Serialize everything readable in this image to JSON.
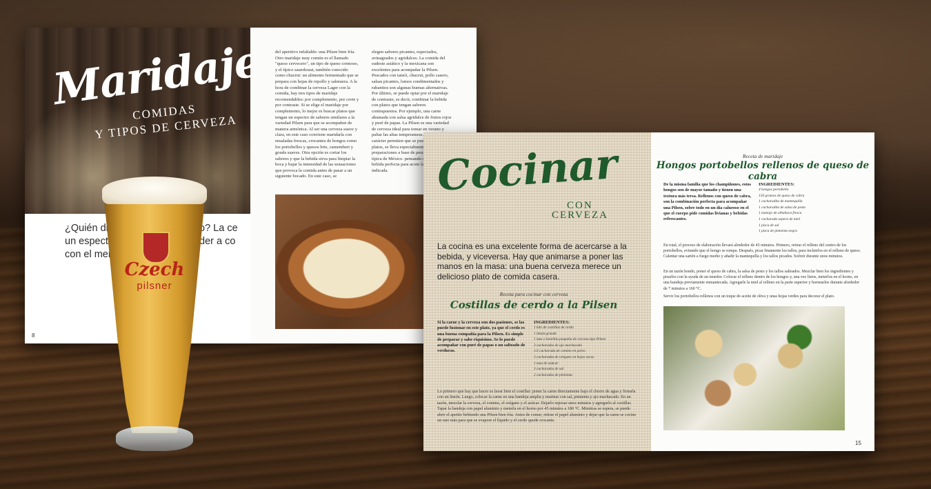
{
  "magazine1": {
    "left_page": {
      "title": "Maridajes",
      "subtitle_line1": "COMIDAS",
      "subtitle_line2": "Y TIPOS DE CERVEZA",
      "intro": "¿Quién dij del maridaje del vino? La ce un espectro y sabores c aprender a co con el menú e",
      "page_number": "8"
    },
    "right_page": {
      "col1": "del aperitivo infaltable: una Pilsen bien fría. Otro maridaje muy común es el llamado \"queso cervecero\", un tipo de queso cremoso, y el típico sauerkraut, también conocido como chucrut: un alimento fermentado que se prepara con hojas de repollo y salmuera. A la hora de combinar la cerveza Lager con la comida, hay tres tipos de maridaje recomendables: por complemento, por corte y por contraste. Si se elige el maridaje por complemento, lo mejor es buscar platos que tengan un espectro de sabores similares a la variedad Pilsen para que se acompañen de manera armónica. Al ser una cerveza suave y clara, en este caso conviene maridarla con ensaladas frescas, crocantes de hongos como los portobellos y quesos brie, camembert y gouda suaves. Otra opción es cortar los sabores y que la bebida sirva para limpiar la boca y bajar la intensidad de las sensaciones que provoca la comida antes de pasar a un siguiente bocado. En este caso, se",
      "col2": "elegen sabores picantes, especiados, avinagrados y agridulces. La comida del sudeste asiático y la mexicana son excelentes para acompañar la Pilsen. Pescados con tatsói, chucrut, pollo casero, salsas picantes, lomos condimentados y rabanitos son algunas buenas alternativas. Por último, se puede optar por el maridaje de contraste, es decir, combinar la bebida con platos que tengan sabores contrapuestos. Por ejemplo, una carne ahumada con salsa agridulce de frutos rojos y puré de papas. La Pilsen es una variedad de cerveza ideal para tomar en verano y paliar las altas temperaturas. Aunque su carácter permiten que se pueda maridar con platos, se lleva especialmente bien preparaciones a base de pesca la cocina típica de México. pensando en crear unos bu bebida perfecta para acom la Pilsen es la indicada."
    }
  },
  "glass": {
    "brand": "Czech",
    "brand2": "pilsner"
  },
  "magazine2": {
    "left_page": {
      "title": "Cocinar",
      "con": "CON",
      "cerveza": "CERVEZA",
      "intro": "La cocina es una excelente forma de acercarse a la bebida, y viceversa. Hay que animarse a poner las manos en la masa: una buena cerveza merece un delicioso plato de comida casera.",
      "kicker": "Receta para cocinar con cerveza",
      "recipe_title": "Costillas de cerdo a la Pilsen",
      "lead": "Si la carne y la cerveza son dos pasiones, se las puede fusionar en este plato, ya que el cerdo es una buena compañía para la Pilsen. Es simple de preparar y sabe riquísimo. Se lo puede acompañar con puré de papas o un salteado de verduras.",
      "ingredients_heading": "INGREDIENTES:",
      "ingredients": [
        "1 kilo de costillas de cerdo",
        "1 limón grande",
        "1 lata o botellita pequeña de cerveza tipo Pilsen",
        "3 cucharadas de ajo machacado",
        "1/2 cucharada de comino en polvo",
        "3 cucharadas de orégano en hojas secas",
        "1 taza de azúcar",
        "3 cucharadas de sal",
        "2 cucharadas de pimienta"
      ],
      "steps": "Lo primero que hay que hacer es lavar bien el costillar: poner la carne directamente bajo el chorro de agua y frotarla con un limón. Luego, colocar la carne en una bandeja amplia y marinar con sal, pimienta y ajo machacado. En un tazón, mezclar la cerveza, el comino, el orégano y el azúcar. Dejarlo reposar unos minutos y agregarlo al costillar. Tapar la bandeja con papel aluminio y meterla en el horno por 45 minutos a 180 °C. Mientras se espera, se puede abrir el apetito bebiendo una Pilsen bien fría. Antes de comer, retirar el papel aluminio y dejar que la carne se cocine un rato más para que se evapore el líquido y el cerdo quede crocante."
    },
    "right_page": {
      "kicker": "Receta de maridaje",
      "recipe_title": "Hongos portobellos rellenos de queso de cabra",
      "lead": "De la misma familia que los champiñones, estos hongos son de mayor tamaño y tienen una textura más tersa. Rellenos con queso de cabra, son la combinación perfecta para acompañar una Pilsen, sobre todo en un día caluroso en el que el cuerpo pide comidas livianas y bebidas refrescantes.",
      "ingredients_heading": "INGREDIENTES:",
      "ingredients": [
        "4 hongos portobello",
        "150 gramos de queso de cabra",
        "1 cucharadita de mantequilla",
        "1 cucharadita de salsa de pesto",
        "1 manojo de albahaca fresca",
        "1 cucharada sopera de miel",
        "1 pizca de sal",
        "1 pizca de pimienta negra"
      ],
      "steps1": "En total, el proceso de elaboración llevará alrededor de 45 minutos. Primero, retirar el relleno del centro de los portobellos, evitando que el hongo se rompa. Después, picar finamente los tallos, para incluirlos en el relleno de queso. Calentar una sartén a fuego medio y añadir la mantequilla y los tallos picados. Sofreír durante unos minutos.",
      "steps2": "En un tazón hondo, poner el queso de cabra, la salsa de pesto y los tallos salteados. Mezclar bien los ingredientes y pisarlos con la ayuda de un tenedor. Colocar el relleno dentro de los hongos y, una vez listos, meterlos en el horno, en una bandeja previamente enmantecada. Agregarle la miel al relleno en la parte superior y hornearlos durante alrededor de 7 minutos a 160 °C.",
      "steps3": "Servir los portobellos rellenos con un toque de aceite de oliva y unas hojas verdes para decorar el plato.",
      "page_number": "15"
    }
  }
}
